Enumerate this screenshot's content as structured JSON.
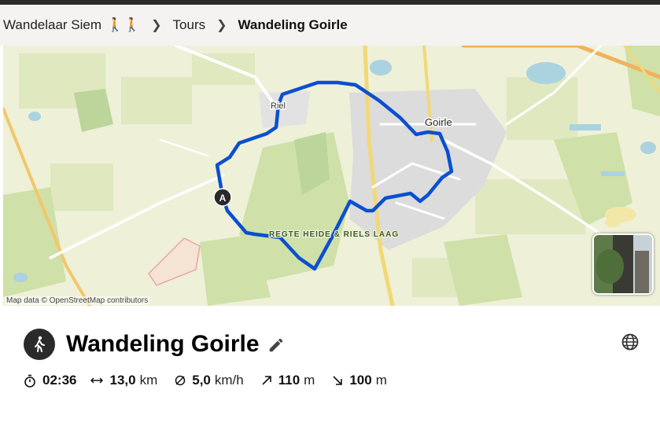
{
  "breadcrumb": {
    "home": "Wandelaar Siem",
    "home_emoji": "🚶🚶",
    "section": "Tours",
    "current": "Wandeling Goirle"
  },
  "map": {
    "labels": {
      "town": "Goirle",
      "village": "Riel",
      "nature_area": "REGTE HEIDE & RIELS LAAG"
    },
    "start_marker": "A",
    "attribution": "Map data © OpenStreetMap contributors",
    "route_color": "#0a4fcf"
  },
  "tour": {
    "title": "Wandeling Goirle",
    "icon": "hiking-icon"
  },
  "stats": {
    "duration": {
      "icon": "stopwatch-icon",
      "value": "02:36"
    },
    "distance": {
      "icon": "horizontal-arrows-icon",
      "value": "13,0",
      "unit": "km"
    },
    "speed": {
      "icon": "average-icon",
      "value": "5,0",
      "unit": "km/h"
    },
    "ascent": {
      "icon": "arrow-up-right-icon",
      "value": "110",
      "unit": "m"
    },
    "descent": {
      "icon": "arrow-down-right-icon",
      "value": "100",
      "unit": "m"
    }
  }
}
